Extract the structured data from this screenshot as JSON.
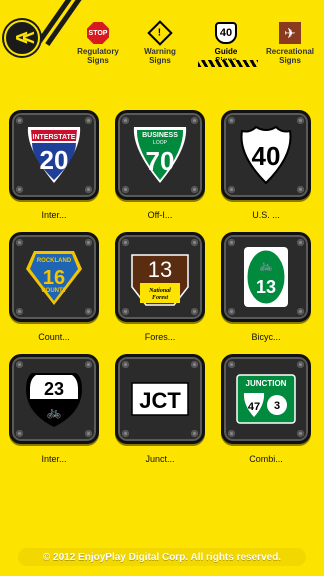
{
  "tabs": [
    {
      "label": "Regulatory\nSigns",
      "icon": "stop-sign-icon",
      "glyph": "STOP"
    },
    {
      "label": "Warning\nSigns",
      "icon": "warning-sign-icon",
      "glyph": "!"
    },
    {
      "label": "Guide\nSigns",
      "icon": "guide-sign-icon",
      "glyph": "40",
      "active": true
    },
    {
      "label": "Recreational\nSigns",
      "icon": "airplane-sign-icon",
      "glyph": "✈"
    }
  ],
  "tiles": [
    {
      "caption": "Inter...",
      "sign": {
        "top": "INTERSTATE",
        "num": "20"
      }
    },
    {
      "caption": "Off-I...",
      "sign": {
        "top": "BUSINESS",
        "sub": "LOOP",
        "num": "70"
      }
    },
    {
      "caption": "U.S. ...",
      "sign": {
        "num": "40"
      }
    },
    {
      "caption": "Count...",
      "sign": {
        "top": "ROCKLAND",
        "num": "16",
        "bottom": "COUNTY"
      }
    },
    {
      "caption": "Fores...",
      "sign": {
        "num": "13",
        "bottom": "National\nForest"
      }
    },
    {
      "caption": "Bicyc...",
      "sign": {
        "num": "13",
        "glyph": "🚲"
      }
    },
    {
      "caption": "Inter...",
      "sign": {
        "num": "23",
        "glyph": "🚲"
      }
    },
    {
      "caption": "Junct...",
      "sign": {
        "num": "JCT"
      }
    },
    {
      "caption": "Combi...",
      "sign": {
        "top": "JUNCTION",
        "num": "47",
        "num2": "3"
      }
    }
  ],
  "footer": "© 2012 EnjoyPlay Digital Corp. All rights reserved.",
  "colors": {
    "background": "#fce300",
    "tile": "#2b2b2b",
    "interstate_blue": "#1f3f99",
    "interstate_red": "#c8102e",
    "business_green": "#008a3e",
    "county_blue": "#1e66b4",
    "county_gold": "#f5c400",
    "forest_brown": "#5a2d10"
  }
}
